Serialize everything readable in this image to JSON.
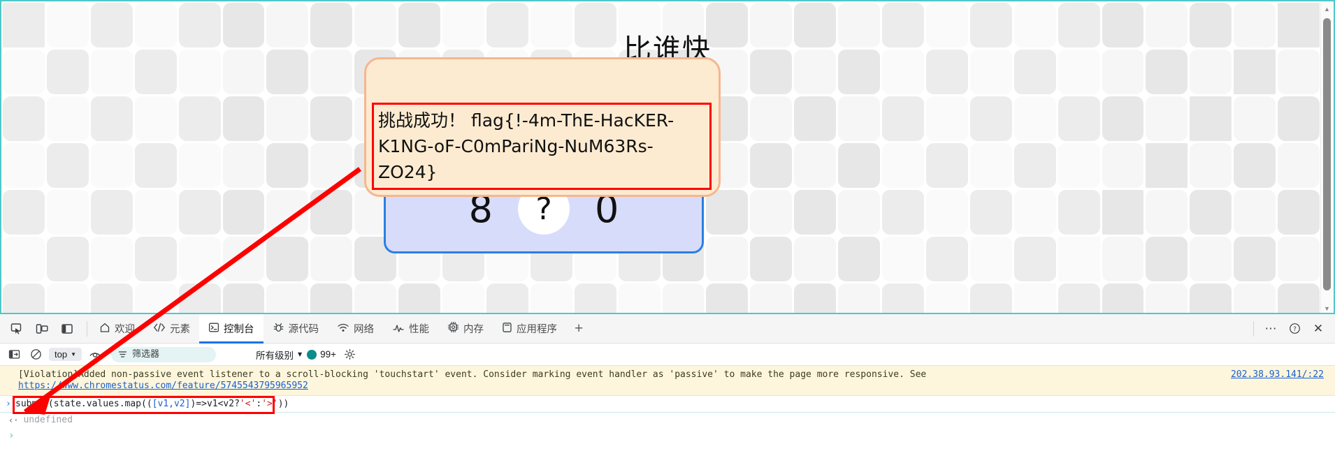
{
  "page": {
    "title": "比谁快",
    "game": {
      "left_number": "8",
      "question_mark": "?",
      "right_number": "0"
    },
    "tooltip": {
      "message": "挑战成功！ flag{!-4m-ThE-HacKER-K1NG-oF-C0mPariNg-NuM63Rs-ZO24}"
    },
    "colors": {
      "viewport_border": "#4ec8c8",
      "tooltip_bg": "#fdebd1",
      "tooltip_border": "#f6b68d",
      "highlight_red": "#ff0000",
      "game_card_bg": "#d8dcfb",
      "game_card_border": "#2b7fe0"
    }
  },
  "devtools": {
    "dock_buttons": [
      {
        "name": "inspect-element",
        "icon": "cursor-box-icon"
      },
      {
        "name": "device-toolbar",
        "icon": "device-icon"
      },
      {
        "name": "dock-side",
        "icon": "panel-icon"
      }
    ],
    "tabs": [
      {
        "label": "欢迎",
        "icon": "home-icon",
        "active": false
      },
      {
        "label": "元素",
        "icon": "code-icon",
        "active": false
      },
      {
        "label": "控制台",
        "icon": "console-icon",
        "active": true
      },
      {
        "label": "源代码",
        "icon": "bug-icon",
        "active": false
      },
      {
        "label": "网络",
        "icon": "wifi-icon",
        "active": false
      },
      {
        "label": "性能",
        "icon": "performance-icon",
        "active": false
      },
      {
        "label": "内存",
        "icon": "memory-icon",
        "active": false
      },
      {
        "label": "应用程序",
        "icon": "application-icon",
        "active": false
      }
    ],
    "add_tab_label": "+",
    "right_buttons": [
      {
        "name": "more-options",
        "label": "⋯"
      },
      {
        "name": "help",
        "label": "?"
      },
      {
        "name": "close-devtools",
        "label": "✕"
      }
    ],
    "console_toolbar": {
      "sidebar_toggle_icon": "sidebar-icon",
      "clear_console_icon": "no-entry-icon",
      "context": "top",
      "live_expression_icon": "eye-icon",
      "filter_icon": "filter-icon",
      "filter_placeholder": "筛选器",
      "filter_value": "",
      "level": "所有级别",
      "message_count": "99+",
      "settings_icon": "gear-icon"
    },
    "console": {
      "violation_text": "[Violation]Added non-passive event listener to a scroll-blocking 'touchstart' event. Consider marking event handler as 'passive' to make the page more responsive. See",
      "violation_link": "https://www.chromestatus.com/feature/5745543795965952",
      "violation_source": "202.38.93.141/:22",
      "command": "submit(state.values.map(([v1,v2])=>v1<v2?'<':'>'))",
      "command_tokens": {
        "p1": "submit(state.values.map((",
        "v1": "[v1,v2]",
        "p2": ")=>v1<v2?",
        "s1": "'<'",
        "p3": ":",
        "s2": "'>'",
        "p4": "))"
      },
      "result": "undefined",
      "result_arrow": "‹·",
      "prompt_symbol": "›",
      "input_prompt_symbol": "›"
    }
  }
}
